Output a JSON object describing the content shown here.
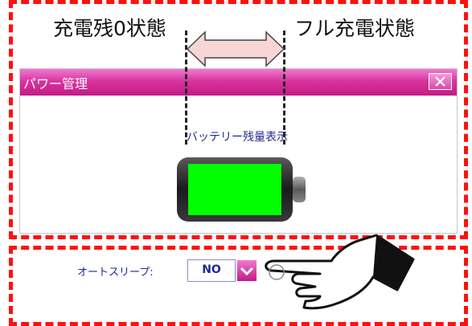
{
  "annotations": {
    "left_label": "充電残0状態",
    "right_label": "フル充電状態"
  },
  "window": {
    "title": "パワー管理",
    "close_symbol": "✕"
  },
  "battery": {
    "label": "バッテリー残量表示",
    "level": 1.0,
    "fill_color": "#00ff00"
  },
  "auto_sleep": {
    "label": "オートスリープ:",
    "value": "NO"
  },
  "colors": {
    "annotation_frame": "#ff1010",
    "title_bar": "#d8359f",
    "text_blue": "#1f2a8c"
  }
}
